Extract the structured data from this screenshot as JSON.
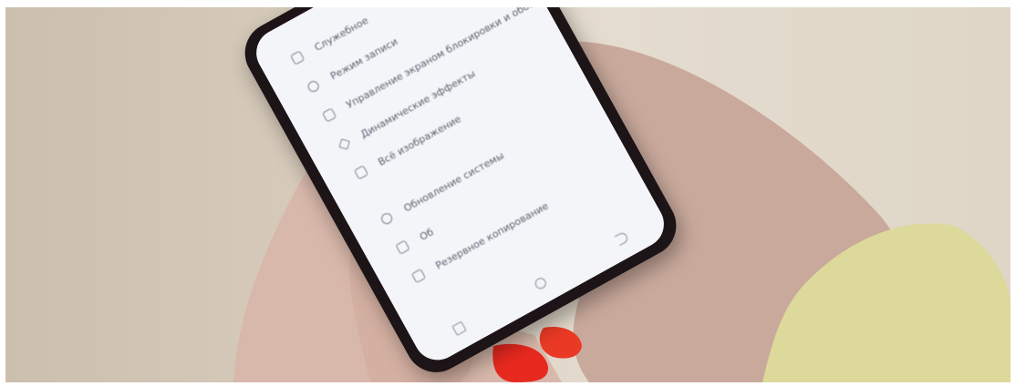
{
  "menu": {
    "items": [
      {
        "label": "Служебное"
      },
      {
        "label": "Режим записи"
      },
      {
        "label": "Управление экраном блокировки и обои"
      },
      {
        "label": "Динамические эффекты"
      },
      {
        "label": "Всё изображение"
      },
      {
        "label": "Обновление системы"
      },
      {
        "label": "Об"
      },
      {
        "label": "Резервное копирование"
      }
    ]
  },
  "colors": {
    "nail_polish": "#e8291f",
    "sleeve": "#dcd99a",
    "screen": "#f4f5f8",
    "phone_frame": "#1c1416"
  }
}
